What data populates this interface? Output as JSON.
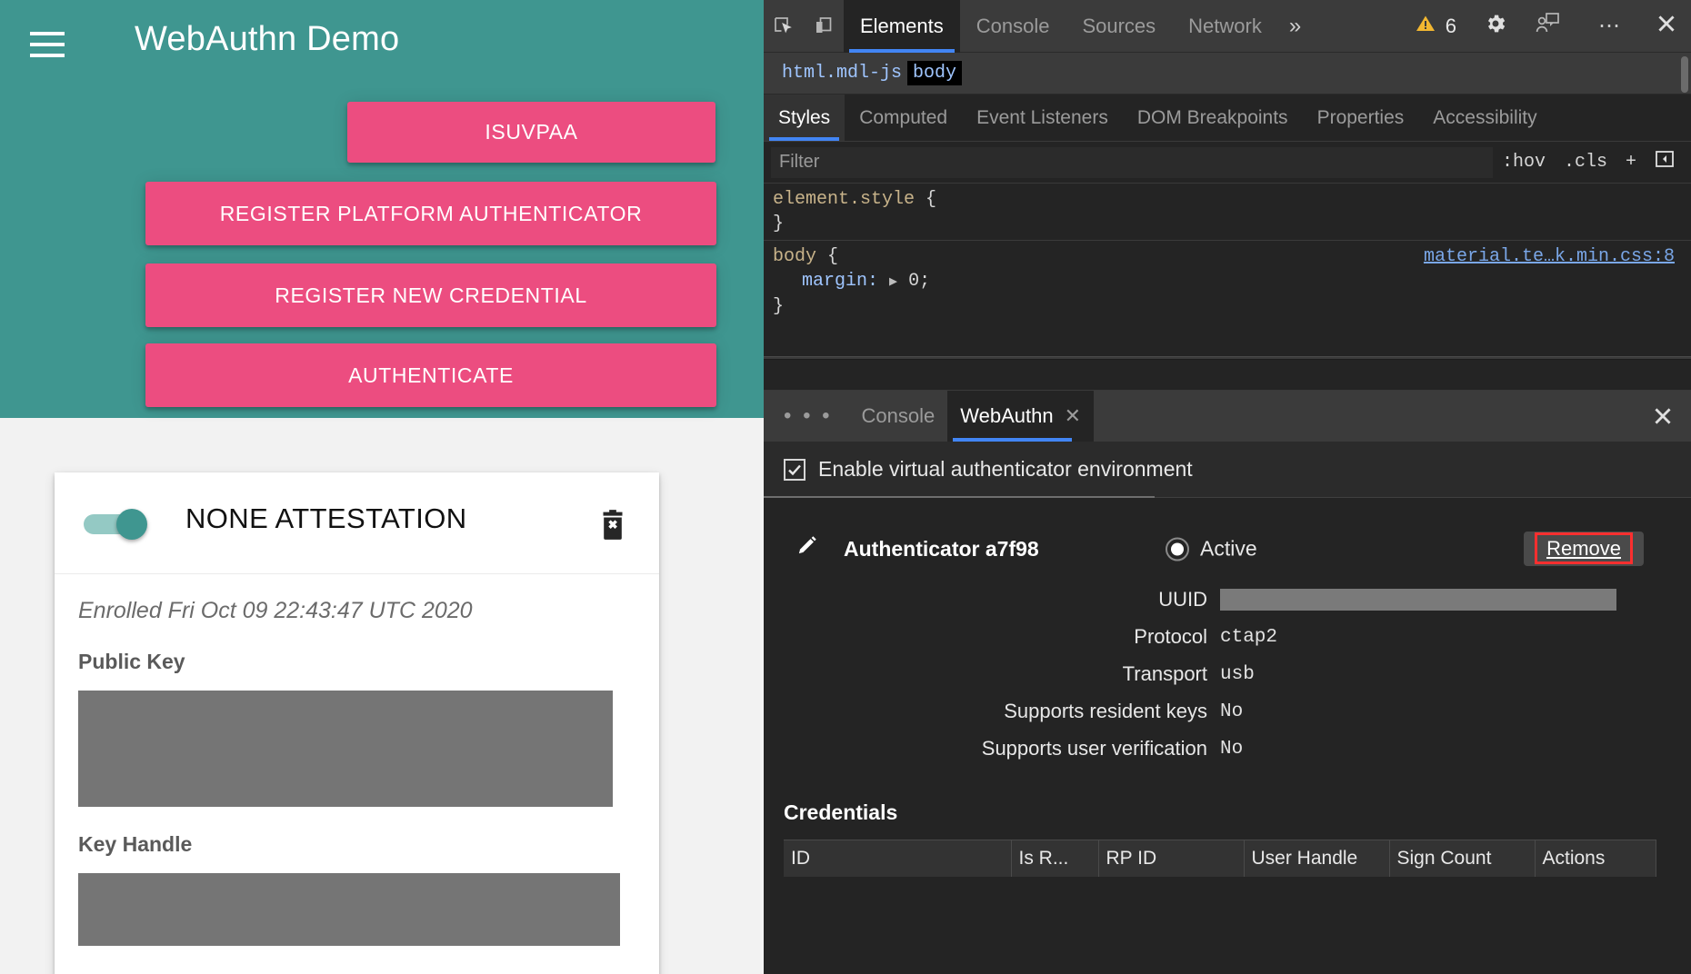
{
  "page": {
    "header": {
      "title": "WebAuthn Demo",
      "menu_icon": "hamburger-menu-icon"
    },
    "buttons": [
      {
        "id": "isuvpaa",
        "label": "ISUVPAA"
      },
      {
        "id": "register-platform-authenticator",
        "label": "REGISTER PLATFORM AUTHENTICATOR"
      },
      {
        "id": "register-new-credential",
        "label": "REGISTER NEW CREDENTIAL"
      },
      {
        "id": "authenticate",
        "label": "AUTHENTICATE"
      }
    ],
    "credential_card": {
      "toggle_on": true,
      "title": "NONE ATTESTATION",
      "delete_icon": "trash-delete-icon",
      "enrolled": "Enrolled Fri Oct 09 22:43:47 UTC 2020",
      "public_key_label": "Public Key",
      "public_key_value": "",
      "key_handle_label": "Key Handle",
      "key_handle_value": ""
    },
    "colors": {
      "teal": "#3f9690",
      "pink": "#ec4d80",
      "page_bg": "#f2f2f2"
    }
  },
  "devtools": {
    "toolbar": {
      "inspect_icon": "inspect-element-icon",
      "device_icon": "device-toolbar-icon",
      "tabs": [
        {
          "label": "Elements",
          "active": true
        },
        {
          "label": "Console",
          "active": false
        },
        {
          "label": "Sources",
          "active": false
        },
        {
          "label": "Network",
          "active": false
        }
      ],
      "more_tabs_icon": "»",
      "warning_icon": "warning-triangle-icon",
      "warning_count": "6",
      "settings_icon": "gear-icon",
      "feedback_icon": "feedback-person-icon",
      "more_options_icon": "⋯",
      "close_icon": "close-icon"
    },
    "breadcrumbs": [
      {
        "label": "html.mdl-js",
        "selected": false
      },
      {
        "label": "body",
        "selected": true
      }
    ],
    "styles_tabs": [
      {
        "label": "Styles",
        "active": true
      },
      {
        "label": "Computed",
        "active": false
      },
      {
        "label": "Event Listeners",
        "active": false
      },
      {
        "label": "DOM Breakpoints",
        "active": false
      },
      {
        "label": "Properties",
        "active": false
      },
      {
        "label": "Accessibility",
        "active": false
      }
    ],
    "filter": {
      "placeholder": "Filter",
      "value": "",
      "hov_label": ":hov",
      "cls_label": ".cls",
      "new_rule_label": "+",
      "toggle_pane_icon": "toggle-sidebar-icon"
    },
    "css_rules": [
      {
        "selector": "element.style",
        "open_brace": "{",
        "close_brace": "}",
        "source": "",
        "declarations": []
      },
      {
        "selector": "body",
        "open_brace": "{",
        "close_brace": "}",
        "source": "material.te…k.min.css:8",
        "declarations": [
          {
            "property": "margin:",
            "value": "0;"
          }
        ]
      }
    ],
    "drawer": {
      "more_icon": "• • •",
      "tabs": [
        {
          "label": "Console",
          "active": false,
          "closable": false
        },
        {
          "label": "WebAuthn",
          "active": true,
          "closable": true,
          "close_icon": "close-icon"
        }
      ],
      "close_drawer_icon": "close-icon"
    },
    "webauthn": {
      "enable_checkbox_checked": true,
      "enable_label": "Enable virtual authenticator environment",
      "authenticator": {
        "edit_icon": "pencil-edit-icon",
        "name": "Authenticator a7f98",
        "state_label": "Active",
        "state_selected": true,
        "remove_label": "Remove",
        "properties": [
          {
            "key": "UUID",
            "value": "",
            "redacted": true
          },
          {
            "key": "Protocol",
            "value": "ctap2",
            "redacted": false
          },
          {
            "key": "Transport",
            "value": "usb",
            "redacted": false
          },
          {
            "key": "Supports resident keys",
            "value": "No",
            "redacted": false
          },
          {
            "key": "Supports user verification",
            "value": "No",
            "redacted": false
          }
        ]
      },
      "credentials": {
        "title": "Credentials",
        "columns": [
          "ID",
          "Is R...",
          "RP ID",
          "User Handle",
          "Sign Count",
          "Actions"
        ],
        "rows": []
      }
    }
  }
}
